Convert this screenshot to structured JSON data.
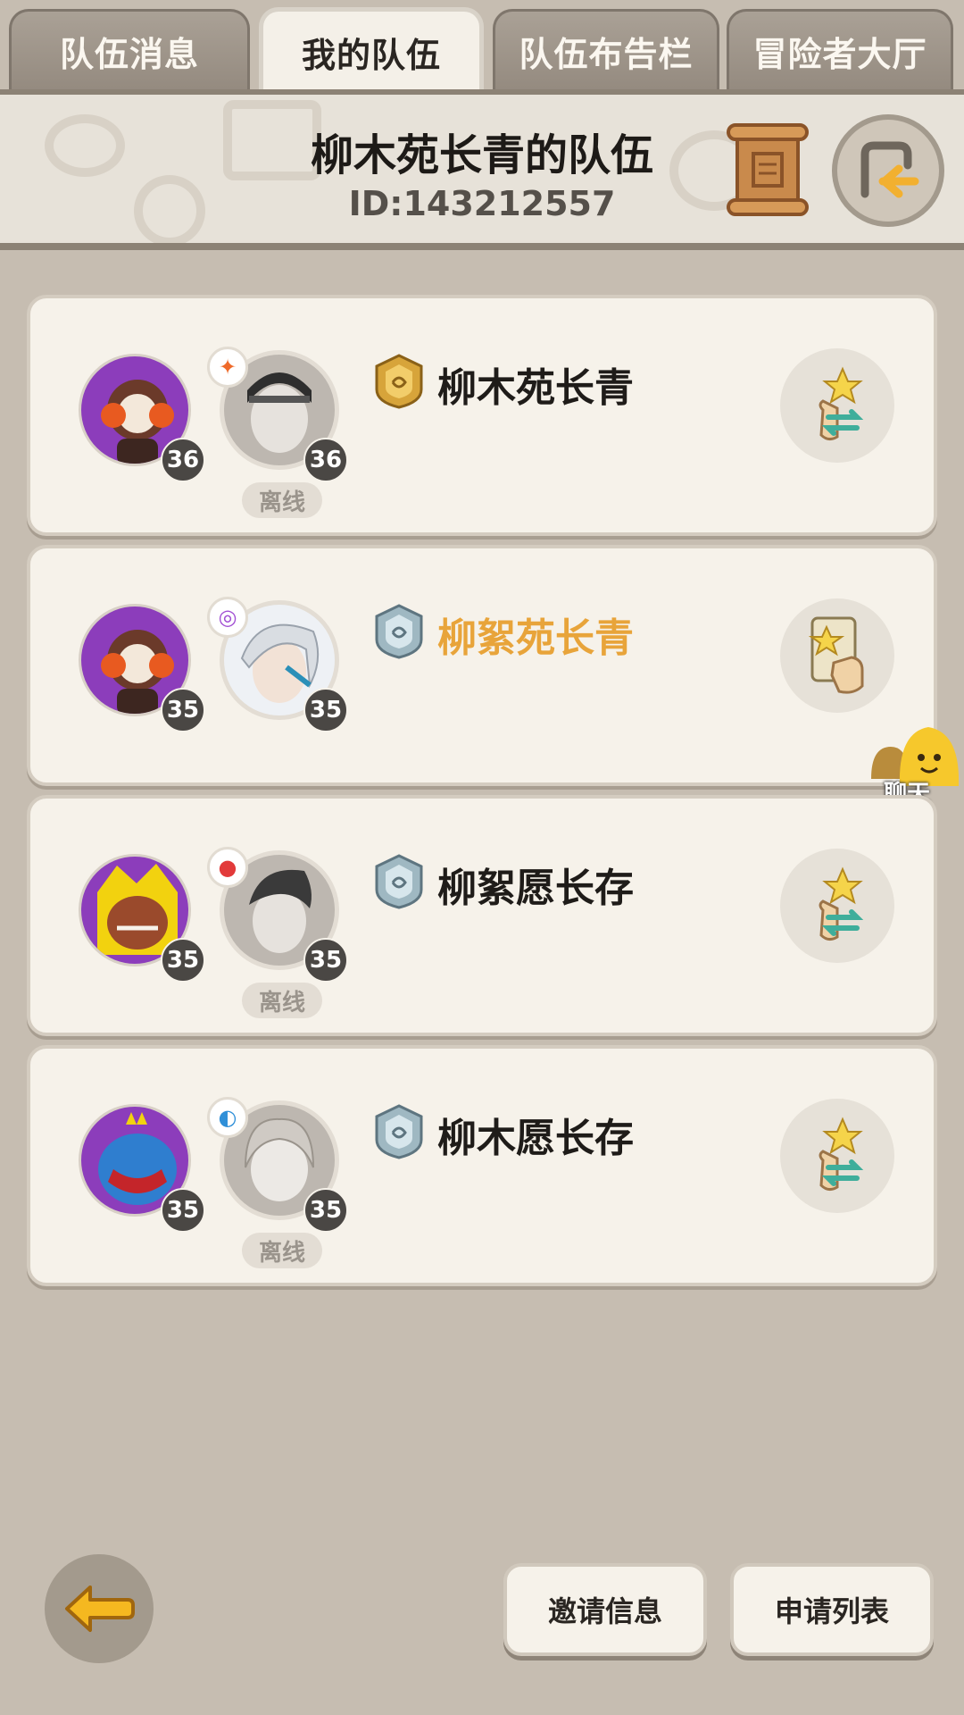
{
  "tabs": [
    {
      "label": "队伍消息",
      "active": false
    },
    {
      "label": "我的队伍",
      "active": true
    },
    {
      "label": "队伍布告栏",
      "active": false
    },
    {
      "label": "冒险者大厅",
      "active": false
    }
  ],
  "team": {
    "name": "柳木苑长青的队伍",
    "id": "ID:143212557"
  },
  "members": [
    {
      "name": "柳木苑长青",
      "pet_level": "36",
      "hero_level": "36",
      "status": "离线",
      "rank_icon": "gold-shield-icon",
      "element_icon": "fire-element-icon",
      "highlight": false
    },
    {
      "name": "柳絮苑长青",
      "pet_level": "35",
      "hero_level": "35",
      "status": "",
      "rank_icon": "silver-shield-icon",
      "element_icon": "psychic-element-icon",
      "highlight": true
    },
    {
      "name": "柳絮愿长存",
      "pet_level": "35",
      "hero_level": "35",
      "status": "离线",
      "rank_icon": "silver-shield-icon",
      "element_icon": "red-element-icon",
      "highlight": false
    },
    {
      "name": "柳木愿长存",
      "pet_level": "35",
      "hero_level": "35",
      "status": "离线",
      "rank_icon": "silver-shield-icon",
      "element_icon": "water-element-icon",
      "highlight": false
    }
  ],
  "chat": {
    "label": "聊天"
  },
  "bottom": {
    "invite_label": "邀请信息",
    "apply_label": "申请列表"
  },
  "colors": {
    "background": "#c6bdb1",
    "card": "#f6f2ea",
    "highlight_name": "#e8a43a",
    "tab_inactive": "#a0978c"
  }
}
